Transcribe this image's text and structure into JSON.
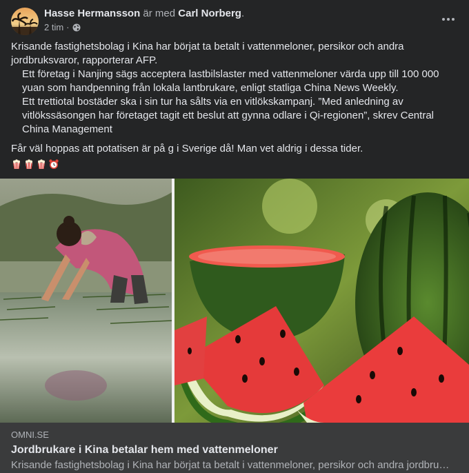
{
  "post": {
    "author": "Hasse Hermansson",
    "connector": "är med",
    "tagged": "Carl Norberg",
    "tagged_suffix": ".",
    "time": "2 tim",
    "time_separator": "·",
    "privacy_icon": "globe-icon",
    "more_icon": "more-horizontal-icon"
  },
  "text": {
    "p1": "Krisande fastighetsbolag i Kina har börjat ta betalt i vattenmeloner, persikor och andra jordbruksvaror, rapporterar AFP.",
    "p2": "Ett företag i Nanjing sägs acceptera lastbilslaster med vattenmeloner värda upp till 100 000 yuan som handpenning från lokala lantbrukare, enligt statliga China News Weekly.",
    "p3": "Ett trettiotal bostäder ska i sin tur ha sålts via en vitlökskampanj. ”Med anledning av vitlökssäsongen har företaget tagit ett beslut att gynna odlare i Qi-regionen”, skrev Central China Management",
    "p4": "Får väl hoppas att potatisen är på g i Sverige då! Man vet aldrig i dessa tider.",
    "emojis": [
      "popcorn-icon",
      "popcorn-icon",
      "popcorn-icon",
      "alarm-clock-icon"
    ]
  },
  "link": {
    "domain": "OMNI.SE",
    "title": "Jordbrukare i Kina betalar hem med vattenmeloner",
    "description": "Krisande fastighetsbolag i Kina har börjat ta betalt i vattenmeloner, persikor och andra jordbruksvaror, rapporterar AFP."
  },
  "colors": {
    "background": "#242526",
    "card": "#3a3b3c",
    "text_primary": "#e4e6eb",
    "text_secondary": "#b0b3b8"
  }
}
